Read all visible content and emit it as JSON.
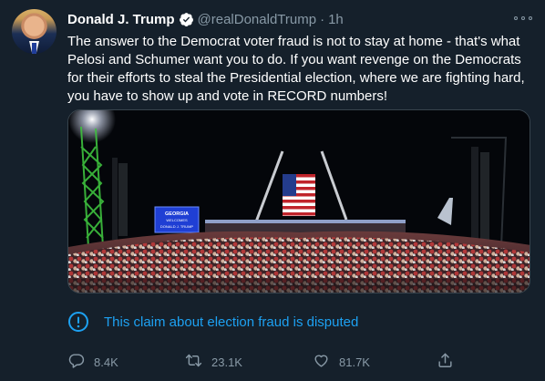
{
  "tweet": {
    "author_name": "Donald J. Trump",
    "handle": "@realDonaldTrump",
    "separator": "·",
    "time": "1h",
    "text": "The answer to the Democrat voter fraud is not to stay at home - that's what Pelosi and Schumer want you to do. If you want revenge on the Democrats for their efforts to steal the Presidential election, where we are fighting hard, you have to show up and vote in RECORD numbers!",
    "media": {
      "sign_line1": "GEORGIA",
      "sign_line2": "WELCOMES",
      "sign_line3": "DONALD J. TRUMP"
    },
    "notice": "This claim about election fraud is disputed",
    "actions": {
      "replies": "8.4K",
      "retweets": "23.1K",
      "likes": "81.7K"
    }
  },
  "icons": [
    "verified-badge-icon",
    "more-options-icon",
    "info-icon",
    "reply-icon",
    "retweet-icon",
    "like-icon",
    "share-icon"
  ],
  "colors": {
    "background": "#15202b",
    "accent": "#1da1f2",
    "secondary_text": "#8899a6",
    "border": "#38444d"
  }
}
